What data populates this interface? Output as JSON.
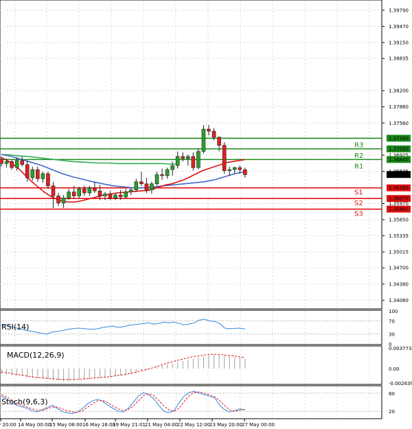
{
  "chart_data": [
    {
      "type": "candlestick",
      "panel": "price",
      "ylim": [
        1.3393,
        1.3995
      ],
      "y_ticks": [
        "1.39790",
        "1.39470",
        "1.39150",
        "1.38835",
        "1.38200",
        "1.37880",
        "1.37560",
        "1.36925",
        "1.36605",
        "1.35970",
        "1.35650",
        "1.35335",
        "1.35015",
        "1.34700",
        "1.34380",
        "1.34060"
      ],
      "last_price": "1.36544",
      "levels": [
        {
          "name": "R3",
          "value": 1.3726,
          "label": "1.37260",
          "color": "#1a8a1a"
        },
        {
          "name": "R2",
          "value": 1.3705,
          "label": "1.37050",
          "color": "#1a8a1a"
        },
        {
          "name": "R1",
          "value": 1.3684,
          "label": "1.36840",
          "color": "#1a8a1a"
        },
        {
          "name": "S1",
          "value": 1.3628,
          "label": "1.36280",
          "color": "#e01010"
        },
        {
          "name": "S2",
          "value": 1.3607,
          "label": "1.36070",
          "color": "#e01010"
        },
        {
          "name": "S3",
          "value": 1.3586,
          "label": "1.35860",
          "color": "#e01010"
        }
      ],
      "candles": [
        [
          1.3684,
          1.369,
          1.367,
          1.3676
        ],
        [
          1.3676,
          1.3686,
          1.3668,
          1.368
        ],
        [
          1.368,
          1.3684,
          1.3664,
          1.3668
        ],
        [
          1.3668,
          1.3688,
          1.3662,
          1.3682
        ],
        [
          1.3682,
          1.369,
          1.367,
          1.3674
        ],
        [
          1.3674,
          1.3682,
          1.364,
          1.3648
        ],
        [
          1.3648,
          1.367,
          1.3642,
          1.3664
        ],
        [
          1.3664,
          1.367,
          1.364,
          1.3646
        ],
        [
          1.3646,
          1.366,
          1.3638,
          1.3656
        ],
        [
          1.3656,
          1.366,
          1.3626,
          1.3632
        ],
        [
          1.3632,
          1.364,
          1.3588,
          1.3612
        ],
        [
          1.3612,
          1.3618,
          1.3592,
          1.3598
        ],
        [
          1.3598,
          1.3614,
          1.3588,
          1.3608
        ],
        [
          1.3608,
          1.3626,
          1.3604,
          1.362
        ],
        [
          1.362,
          1.3632,
          1.3606,
          1.3612
        ],
        [
          1.3612,
          1.363,
          1.3608,
          1.3626
        ],
        [
          1.3626,
          1.3632,
          1.3612,
          1.3618
        ],
        [
          1.3618,
          1.3632,
          1.3612,
          1.3628
        ],
        [
          1.3628,
          1.364,
          1.3618,
          1.3622
        ],
        [
          1.3622,
          1.3634,
          1.3604,
          1.3612
        ],
        [
          1.3612,
          1.362,
          1.3604,
          1.3616
        ],
        [
          1.3616,
          1.3622,
          1.3604,
          1.3608
        ],
        [
          1.3608,
          1.3618,
          1.3604,
          1.3614
        ],
        [
          1.3614,
          1.3624,
          1.3604,
          1.361
        ],
        [
          1.361,
          1.3626,
          1.3606,
          1.362
        ],
        [
          1.362,
          1.3628,
          1.3614,
          1.3624
        ],
        [
          1.3624,
          1.3646,
          1.362,
          1.364
        ],
        [
          1.364,
          1.366,
          1.3632,
          1.3636
        ],
        [
          1.3636,
          1.3648,
          1.3618,
          1.3624
        ],
        [
          1.3624,
          1.364,
          1.3616,
          1.3636
        ],
        [
          1.3636,
          1.366,
          1.3632,
          1.3654
        ],
        [
          1.3654,
          1.3666,
          1.3644,
          1.3652
        ],
        [
          1.3652,
          1.3668,
          1.3646,
          1.3664
        ],
        [
          1.3664,
          1.368,
          1.3652,
          1.3672
        ],
        [
          1.3672,
          1.37,
          1.3666,
          1.369
        ],
        [
          1.369,
          1.3698,
          1.368,
          1.3686
        ],
        [
          1.3686,
          1.3694,
          1.3672,
          1.369
        ],
        [
          1.369,
          1.3698,
          1.3662,
          1.3668
        ],
        [
          1.3668,
          1.3706,
          1.3664,
          1.37
        ],
        [
          1.37,
          1.3752,
          1.3696,
          1.3744
        ],
        [
          1.3744,
          1.3752,
          1.3732,
          1.374
        ],
        [
          1.374,
          1.3746,
          1.3722,
          1.3728
        ],
        [
          1.3728,
          1.373,
          1.37,
          1.3712
        ],
        [
          1.3712,
          1.3718,
          1.3656,
          1.3662
        ],
        [
          1.3662,
          1.367,
          1.3652,
          1.3664
        ],
        [
          1.3664,
          1.367,
          1.3656,
          1.3668
        ],
        [
          1.3668,
          1.3672,
          1.3656,
          1.3664
        ],
        [
          1.3664,
          1.3668,
          1.3648,
          1.3654
        ]
      ],
      "ma_short": [
        1.3688,
        1.3682,
        1.3674,
        1.3664,
        1.3652,
        1.364,
        1.363,
        1.362,
        1.3612,
        1.3606,
        1.3602,
        1.36,
        1.36,
        1.3602,
        1.3605,
        1.3608,
        1.3611,
        1.3614,
        1.3616,
        1.3618,
        1.3619,
        1.362,
        1.3621,
        1.3622,
        1.3623,
        1.3626,
        1.363,
        1.3634,
        1.3636,
        1.364,
        1.3644,
        1.365,
        1.3656,
        1.3662,
        1.3666,
        1.367,
        1.3674,
        1.3678,
        1.368,
        1.3682,
        1.3684
      ],
      "ma_mid": [
        1.3694,
        1.369,
        1.3684,
        1.3678,
        1.3672,
        1.3664,
        1.3656,
        1.365,
        1.3645,
        1.364,
        1.3636,
        1.3632,
        1.363,
        1.3628,
        1.3628,
        1.363,
        1.3632,
        1.3634,
        1.3636,
        1.3638,
        1.364,
        1.3644,
        1.365,
        1.3656,
        1.366
      ],
      "ma_long": [
        1.3694,
        1.3693,
        1.3691,
        1.369,
        1.3688,
        1.3686,
        1.3684,
        1.3682,
        1.368,
        1.3679,
        1.3678,
        1.3677,
        1.3677,
        1.3676,
        1.3676,
        1.3676,
        1.3676,
        1.3676,
        1.3676,
        1.3675,
        1.3675
      ],
      "colors": {
        "up": "#2aa02a",
        "down": "#e02020",
        "ma_short": "#e01010",
        "ma_mid": "#4466cc",
        "ma_long": "#33aa55"
      }
    },
    {
      "type": "line",
      "panel": "rsi",
      "title": "RSI(14)",
      "ylim": [
        0,
        100
      ],
      "y_ticks": [
        "100",
        "70",
        "30",
        "0"
      ],
      "values": [
        55,
        58,
        52,
        48,
        45,
        40,
        38,
        35,
        32,
        30,
        36,
        38,
        40,
        44,
        46,
        48,
        47,
        45,
        44,
        46,
        50,
        52,
        54,
        50,
        52,
        56,
        58,
        60,
        62,
        64,
        60,
        62,
        66,
        64,
        66,
        62,
        58,
        60,
        64,
        72,
        75,
        70,
        68,
        62,
        48,
        46,
        47,
        48,
        45
      ],
      "color": "#3388dd"
    },
    {
      "type": "bar",
      "panel": "macd",
      "title": "MACD(12,26,9)",
      "ylim": [
        -0.002639,
        0.003773
      ],
      "y_ticks": [
        "0.003773",
        "0.00",
        "-0.002639"
      ],
      "values": [
        -0.001,
        -0.0011,
        -0.0012,
        -0.0013,
        -0.0014,
        -0.0016,
        -0.0017,
        -0.0018,
        -0.0019,
        -0.002,
        -0.0021,
        -0.0022,
        -0.0023,
        -0.0023,
        -0.0022,
        -0.0021,
        -0.002,
        -0.0019,
        -0.0018,
        -0.0017,
        -0.0016,
        -0.0015,
        -0.0014,
        -0.0013,
        -0.0012,
        -0.001,
        -0.0008,
        -0.0005,
        -0.0003,
        0.0,
        0.0003,
        0.0006,
        0.0008,
        0.001,
        0.0012,
        0.0014,
        0.0016,
        0.0018,
        0.002,
        0.0022,
        0.0024,
        0.0025,
        0.0026,
        0.0025,
        0.0023,
        0.0022,
        0.002,
        0.0018
      ],
      "signal": [
        -0.0006,
        -0.0008,
        -0.001,
        -0.0012,
        -0.0014,
        -0.0016,
        -0.0017,
        -0.0018,
        -0.0019,
        -0.002,
        -0.002,
        -0.002,
        -0.0019,
        -0.0018,
        -0.0017,
        -0.0016,
        -0.0015,
        -0.0013,
        -0.0011,
        -0.0009,
        -0.0006,
        -0.0003,
        0.0,
        0.0004,
        0.0008,
        0.0012,
        0.0015,
        0.0018,
        0.0021,
        0.0023,
        0.0025,
        0.0026,
        0.0026,
        0.0025,
        0.0024,
        0.0022,
        0.002
      ],
      "colors": {
        "bars": "#a0a0a0",
        "signal": "#e01010"
      }
    },
    {
      "type": "line",
      "panel": "stoch",
      "title": "Stoch(9,6,3)",
      "ylim": [
        0,
        100
      ],
      "y_ticks": [
        "80",
        "20"
      ],
      "k": [
        70,
        62,
        50,
        40,
        35,
        30,
        22,
        18,
        25,
        32,
        40,
        30,
        20,
        15,
        12,
        18,
        30,
        45,
        55,
        60,
        52,
        40,
        30,
        20,
        18,
        30,
        50,
        70,
        82,
        75,
        62,
        40,
        20,
        15,
        22,
        48,
        70,
        82,
        86,
        80,
        75,
        70,
        65,
        40,
        25,
        18,
        22,
        28,
        25
      ],
      "d": [
        75,
        68,
        58,
        48,
        40,
        34,
        28,
        24,
        22,
        28,
        34,
        34,
        28,
        22,
        18,
        16,
        22,
        34,
        46,
        55,
        56,
        48,
        38,
        28,
        22,
        26,
        38,
        55,
        72,
        78,
        72,
        56,
        38,
        24,
        20,
        30,
        52,
        72,
        82,
        84,
        80,
        74,
        68,
        55,
        38,
        25,
        20,
        24,
        26
      ],
      "colors": {
        "k": "#3388dd",
        "d": "#e01010"
      }
    }
  ],
  "x_labels": [
    "y 20:00",
    "14 May 00:00",
    "15 May 08:00",
    "16 May 16:00",
    "19 May 21:01",
    "21 May 04:00",
    "22 May 12:00",
    "23 May 20:00",
    "27 May 00:00"
  ]
}
